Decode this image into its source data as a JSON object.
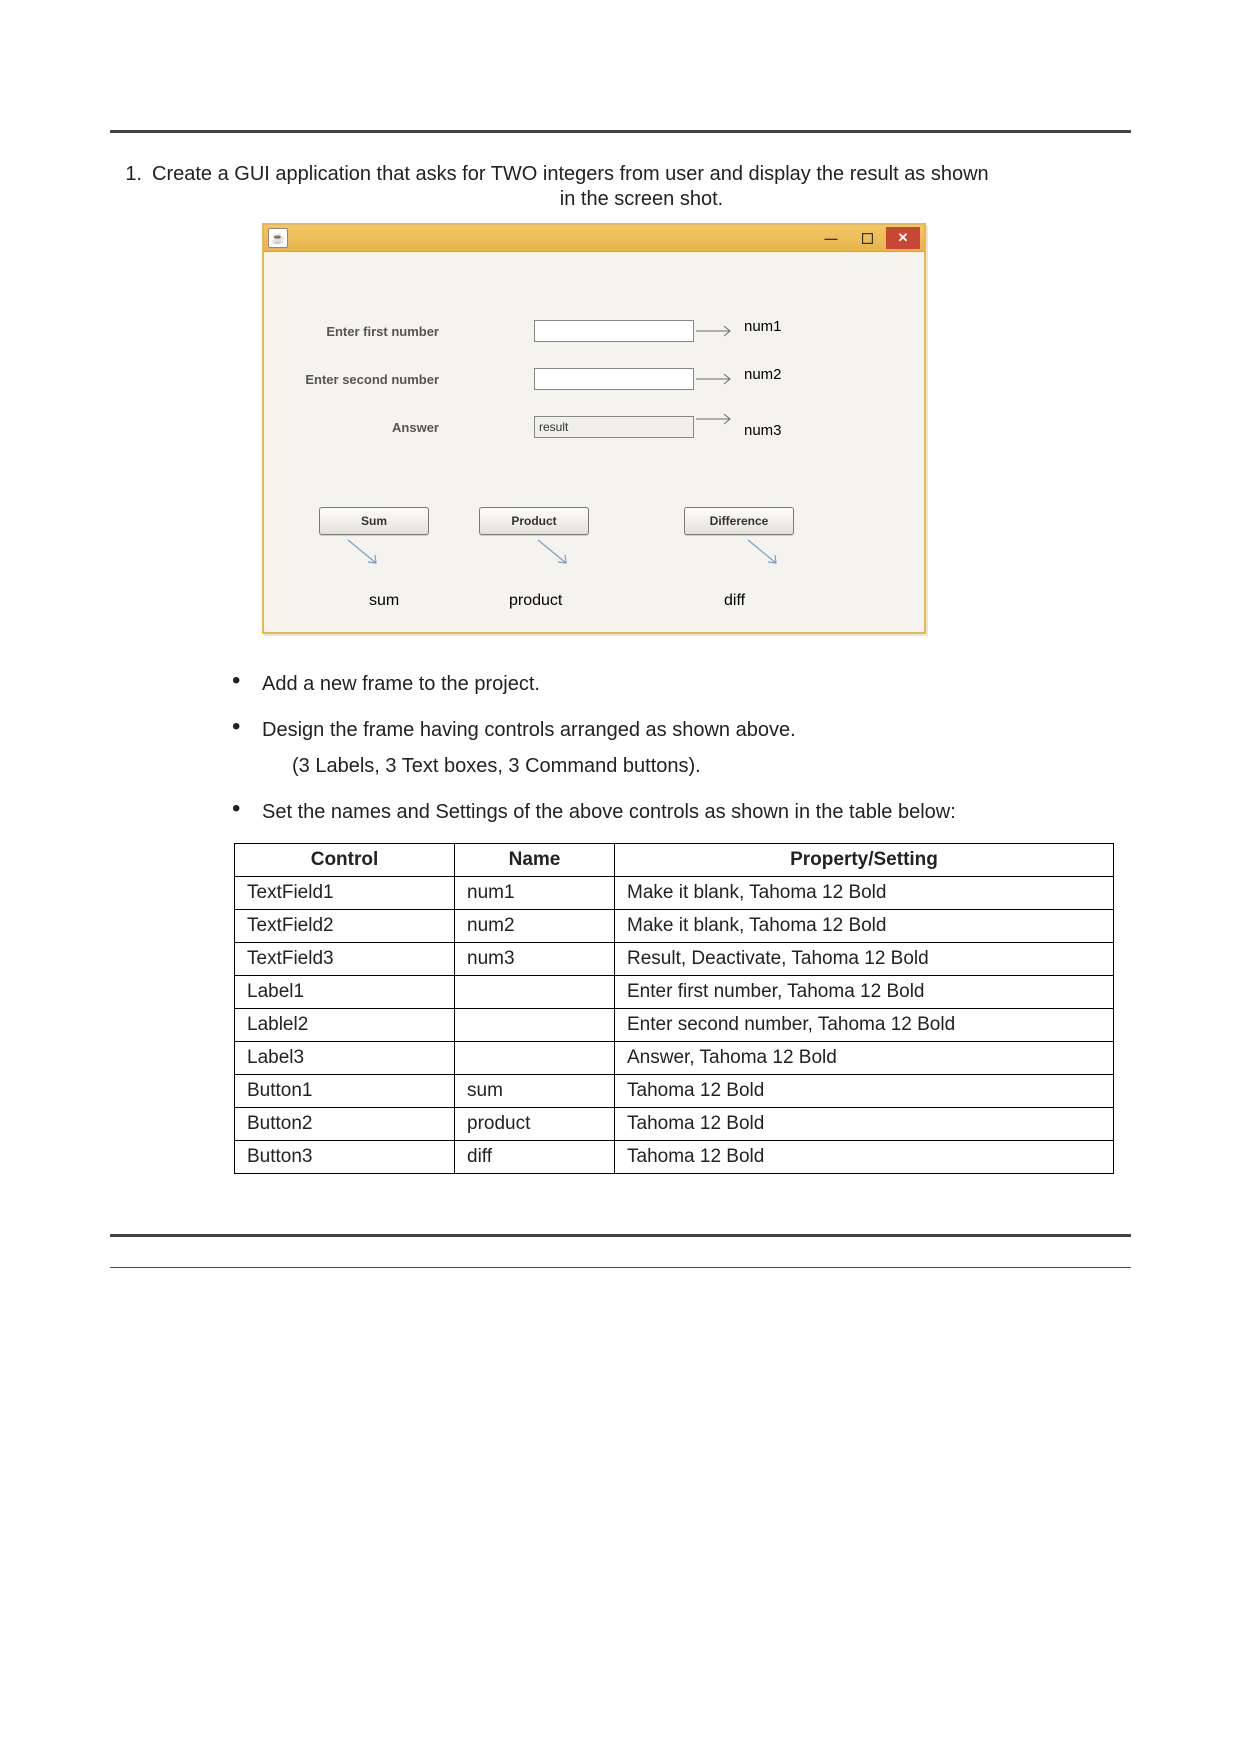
{
  "question": {
    "number": "1.",
    "text_line1": "Create a GUI application that asks for TWO integers from user  and display the result as  shown",
    "text_line2": "in the screen shot."
  },
  "app": {
    "title_icon": "java-icon",
    "labels": {
      "first": "Enter first number",
      "second": "Enter second number",
      "answer": "Answer"
    },
    "fields": {
      "num1_value": "",
      "num2_value": "",
      "num3_value": "result"
    },
    "annotations": {
      "num1": "num1",
      "num2": "num2",
      "num3": "num3",
      "sum_ann": "sum",
      "product_ann": "product",
      "diff_ann": "diff"
    },
    "buttons": {
      "sum": "Sum",
      "product": "Product",
      "difference": "Difference"
    }
  },
  "bullets": {
    "b1": "Add a new frame to the project.",
    "b2": "Design the frame having controls arranged as shown above.",
    "b2_sub": "(3 Labels, 3 Text boxes, 3 Command buttons).",
    "b3": "Set the names and Settings of the above controls as shown in the table below:"
  },
  "table": {
    "headers": {
      "c1": "Control",
      "c2": "Name",
      "c3": "Property/Setting"
    },
    "rows": [
      {
        "c1": "TextField1",
        "c2": "num1",
        "c3": "Make it blank, Tahoma 12 Bold"
      },
      {
        "c1": "TextField2",
        "c2": "num2",
        "c3": "Make it blank, Tahoma 12 Bold"
      },
      {
        "c1": "TextField3",
        "c2": "num3",
        "c3": "Result, Deactivate, Tahoma 12 Bold"
      },
      {
        "c1": "Label1",
        "c2": "",
        "c3": "Enter first number, Tahoma 12 Bold"
      },
      {
        "c1": "Lablel2",
        "c2": "",
        "c3": "Enter second number, Tahoma 12 Bold"
      },
      {
        "c1": "Label3",
        "c2": "",
        "c3": "Answer, Tahoma 12 Bold"
      },
      {
        "c1": "Button1",
        "c2": "sum",
        "c3": "Tahoma 12 Bold"
      },
      {
        "c1": "Button2",
        "c2": "product",
        "c3": "Tahoma 12 Bold"
      },
      {
        "c1": "Button3",
        "c2": "diff",
        "c3": "Tahoma 12 Bold"
      }
    ]
  }
}
